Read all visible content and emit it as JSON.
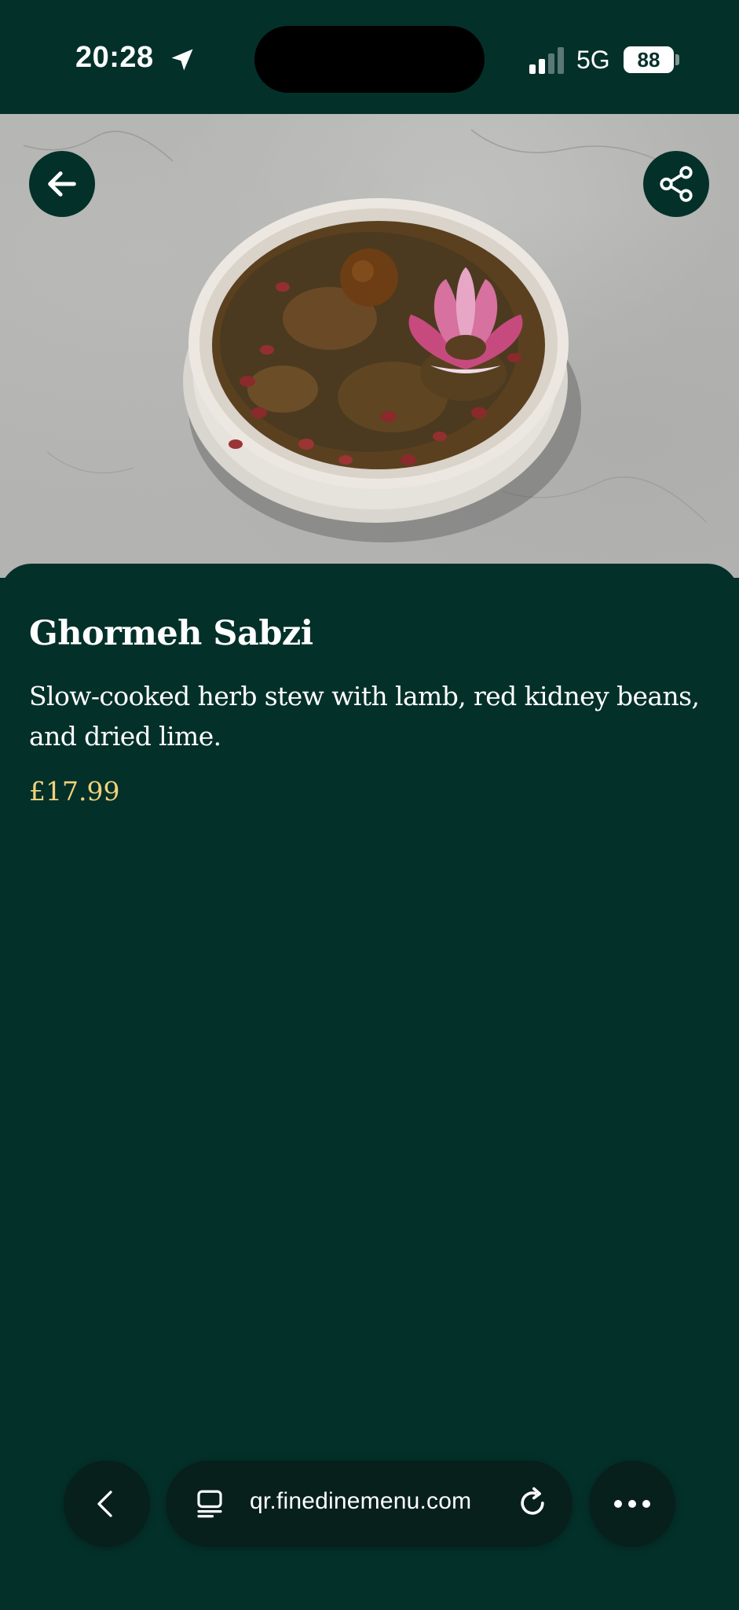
{
  "status_bar": {
    "time": "20:28",
    "network": "5G",
    "battery": "88",
    "icons": [
      "location-arrow-icon",
      "signal-icon",
      "battery-icon"
    ]
  },
  "hero": {
    "back_icon": "arrow-left-icon",
    "share_icon": "share-icon"
  },
  "item": {
    "name": "Ghormeh Sabzi",
    "description": "Slow-cooked herb stew with lamb, red kidney beans, and dried lime.",
    "price": "£17.99"
  },
  "browser": {
    "url": "qr.finedinemenu.com",
    "icons": [
      "chevron-left-icon",
      "reader-icon",
      "reload-icon",
      "more-icon"
    ]
  },
  "colors": {
    "background": "#04302a",
    "price": "#f1d27a",
    "toolbar": "#07201c"
  }
}
